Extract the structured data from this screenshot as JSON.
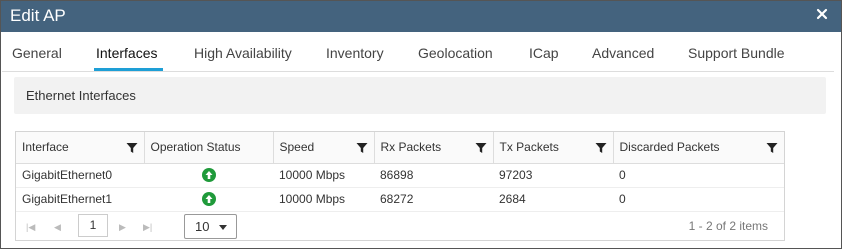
{
  "dialog": {
    "title": "Edit AP"
  },
  "tabs": [
    {
      "label": "General"
    },
    {
      "label": "Interfaces"
    },
    {
      "label": "High Availability"
    },
    {
      "label": "Inventory"
    },
    {
      "label": "Geolocation"
    },
    {
      "label": "ICap"
    },
    {
      "label": "Advanced"
    },
    {
      "label": "Support Bundle"
    }
  ],
  "active_tab": "Interfaces",
  "section": {
    "title": "Ethernet Interfaces"
  },
  "table": {
    "headers": [
      "Interface",
      "Operation Status",
      "Speed",
      "Rx Packets",
      "Tx Packets",
      "Discarded Packets"
    ],
    "rows": [
      {
        "interface": "GigabitEthernet0",
        "status_icon": "status-up-icon",
        "speed": "10000 Mbps",
        "rx": "86898",
        "tx": "97203",
        "discarded": "0"
      },
      {
        "interface": "GigabitEthernet1",
        "status_icon": "status-up-icon",
        "speed": "10000 Mbps",
        "rx": "68272",
        "tx": "2684",
        "discarded": "0"
      }
    ]
  },
  "pager": {
    "page": "1",
    "page_size": "10",
    "count_text": "1 - 2 of 2 items"
  },
  "colors": {
    "titlebar": "#44637e",
    "accent": "#1e9fd6",
    "status_up": "#1f9a3a"
  }
}
